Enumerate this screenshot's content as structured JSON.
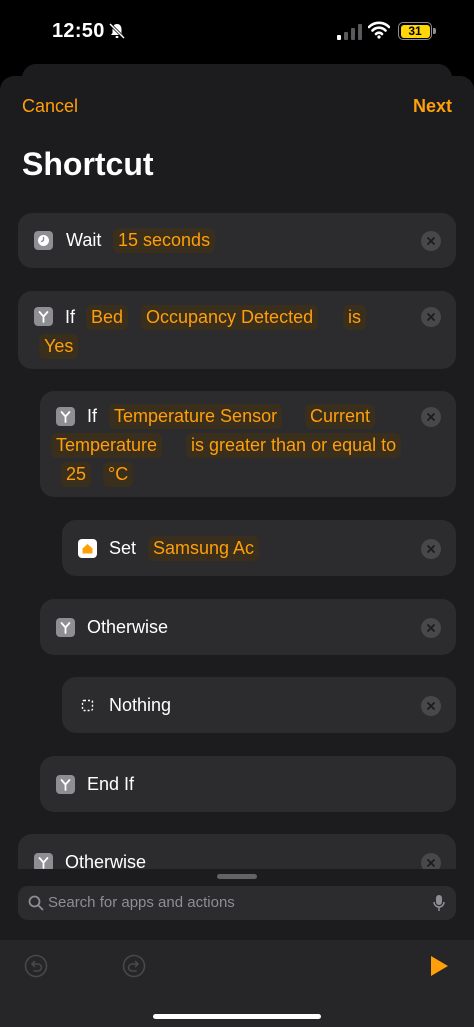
{
  "status": {
    "time": "12:50",
    "battery": "31"
  },
  "nav": {
    "cancel": "Cancel",
    "next": "Next"
  },
  "title": "Shortcut",
  "actions": {
    "wait": {
      "keyword": "Wait",
      "value": "15 seconds"
    },
    "if1": {
      "keyword": "If",
      "tokens": [
        "Bed",
        "Occupancy Detected",
        "is",
        "Yes"
      ]
    },
    "if2": {
      "keyword": "If",
      "tokens": [
        "Temperature Sensor",
        "Current",
        "Temperature",
        "is greater than or equal to",
        "25",
        "°C"
      ]
    },
    "set": {
      "keyword": "Set",
      "value": "Samsung Ac"
    },
    "otherwise1": {
      "keyword": "Otherwise"
    },
    "nothing": {
      "keyword": "Nothing"
    },
    "endif": {
      "keyword": "End If"
    },
    "otherwise2": {
      "keyword": "Otherwise"
    }
  },
  "search": {
    "placeholder": "Search for apps and actions"
  },
  "colors": {
    "accent": "#ff9f0a",
    "background": "#1c1c1e",
    "card": "#2c2c2e"
  },
  "icons": [
    "clock-icon",
    "branch-icon",
    "home-icon",
    "dashed-square-icon",
    "search-icon",
    "mic-icon",
    "undo-icon",
    "redo-icon",
    "play-icon",
    "clear-icon"
  ]
}
